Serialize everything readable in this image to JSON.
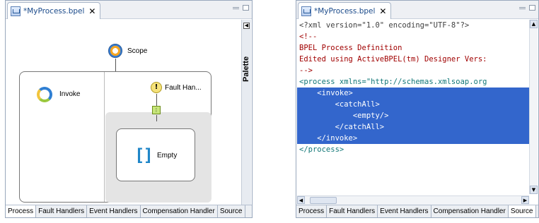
{
  "left_editor": {
    "tab_title": "*MyProcess.bpel",
    "close_glyph": "✕",
    "palette_label": "Palette",
    "diagram": {
      "scope_label": "Scope",
      "invoke_label": "Invoke",
      "fault_label": "Fault Han...",
      "empty_label": "Empty",
      "fault_glyph": "!"
    },
    "bottom_tabs": [
      "Process",
      "Fault Handlers",
      "Event Handlers",
      "Compensation Handler",
      "Source"
    ],
    "active_tab": "Process"
  },
  "right_editor": {
    "tab_title": "*MyProcess.bpel",
    "close_glyph": "✕",
    "source_lines": [
      "<?xml version=\"1.0\" encoding=\"UTF-8\"?>",
      "<!--",
      "BPEL Process Definition",
      "Edited using ActiveBPEL(tm) Designer Vers:",
      "-->",
      "<process xmlns=\"http://schemas.xmlsoap.org",
      "    <invoke>",
      "        <catchAll>",
      "            <empty/>",
      "        </catchAll>",
      "    </invoke>",
      "</process>"
    ],
    "bottom_tabs": [
      "Process",
      "Fault Handlers",
      "Event Handlers",
      "Compensation Handler",
      "Source"
    ],
    "active_tab": "Source"
  },
  "colors": {
    "selection": "#3366cc",
    "comment": "#a00000",
    "tag": "#117777",
    "string": "#2a00ff"
  },
  "icons": [
    "bpel-file-icon",
    "scope-icon",
    "invoke-icon",
    "fault-handler-icon",
    "catch-all-icon",
    "empty-icon",
    "palette-collapse-icon"
  ]
}
